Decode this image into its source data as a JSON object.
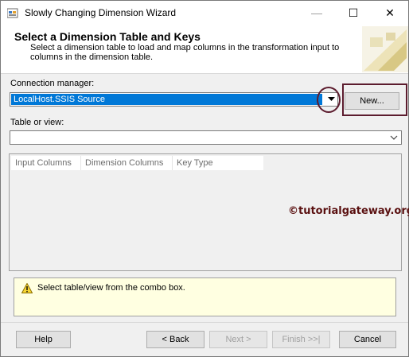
{
  "window": {
    "title": "Slowly Changing Dimension Wizard",
    "controls": {
      "minimize": "—",
      "maximize": "☐",
      "close": "✕"
    }
  },
  "header": {
    "title": "Select a Dimension Table and Keys",
    "description": "Select a dimension table to load and map columns in the transformation input to columns in the dimension table."
  },
  "connection": {
    "label": "Connection manager:",
    "selected": "LocalHost.SSIS Source",
    "new_button": "New..."
  },
  "table": {
    "label": "Table or view:",
    "selected": ""
  },
  "grid": {
    "columns": [
      "Input Columns",
      "Dimension Columns",
      "Key Type"
    ],
    "rows": []
  },
  "watermark": "©tutorialgateway.org",
  "message": {
    "icon": "warning-icon",
    "text": "Select table/view from the combo box."
  },
  "footer": {
    "help": "Help",
    "back": "< Back",
    "next": "Next >",
    "finish": "Finish >>|",
    "cancel": "Cancel"
  },
  "colors": {
    "selection": "#0078d7",
    "annotation": "#5c1c2e",
    "message_bg": "#ffffe1",
    "watermark": "#5a1010"
  }
}
